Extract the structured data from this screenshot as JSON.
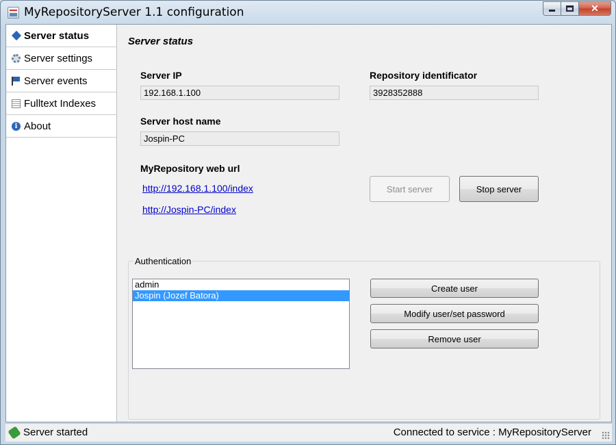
{
  "window": {
    "title": "MyRepositoryServer 1.1 configuration",
    "close_glyph": "✕"
  },
  "sidebar": {
    "items": [
      {
        "label": "Server status",
        "icon": "diamond-icon",
        "active": true
      },
      {
        "label": "Server settings",
        "icon": "gear-icon"
      },
      {
        "label": "Server events",
        "icon": "flag-icon"
      },
      {
        "label": "Fulltext Indexes",
        "icon": "document-icon"
      },
      {
        "label": "About",
        "icon": "info-icon",
        "glyph": "i"
      }
    ]
  },
  "main": {
    "title": "Server status",
    "server_ip": {
      "label": "Server IP",
      "value": "192.168.1.100"
    },
    "repository_id": {
      "label": "Repository identificator",
      "value": "3928352888"
    },
    "host_name": {
      "label": "Server host name",
      "value": "Jospin-PC"
    },
    "web_url": {
      "label": "MyRepository web url",
      "links": [
        "http://192.168.1.100/index",
        "http://Jospin-PC/index"
      ]
    },
    "start_button": "Start server",
    "stop_button": "Stop server"
  },
  "authentication": {
    "legend": "Authentication",
    "users": [
      "admin",
      "Jospin (Jozef Batora)"
    ],
    "selected_index": 1,
    "create_button": "Create user",
    "modify_button": "Modify user/set password",
    "remove_button": "Remove user"
  },
  "statusbar": {
    "left": "Server started",
    "right": "Connected to service : MyRepositoryServer"
  }
}
